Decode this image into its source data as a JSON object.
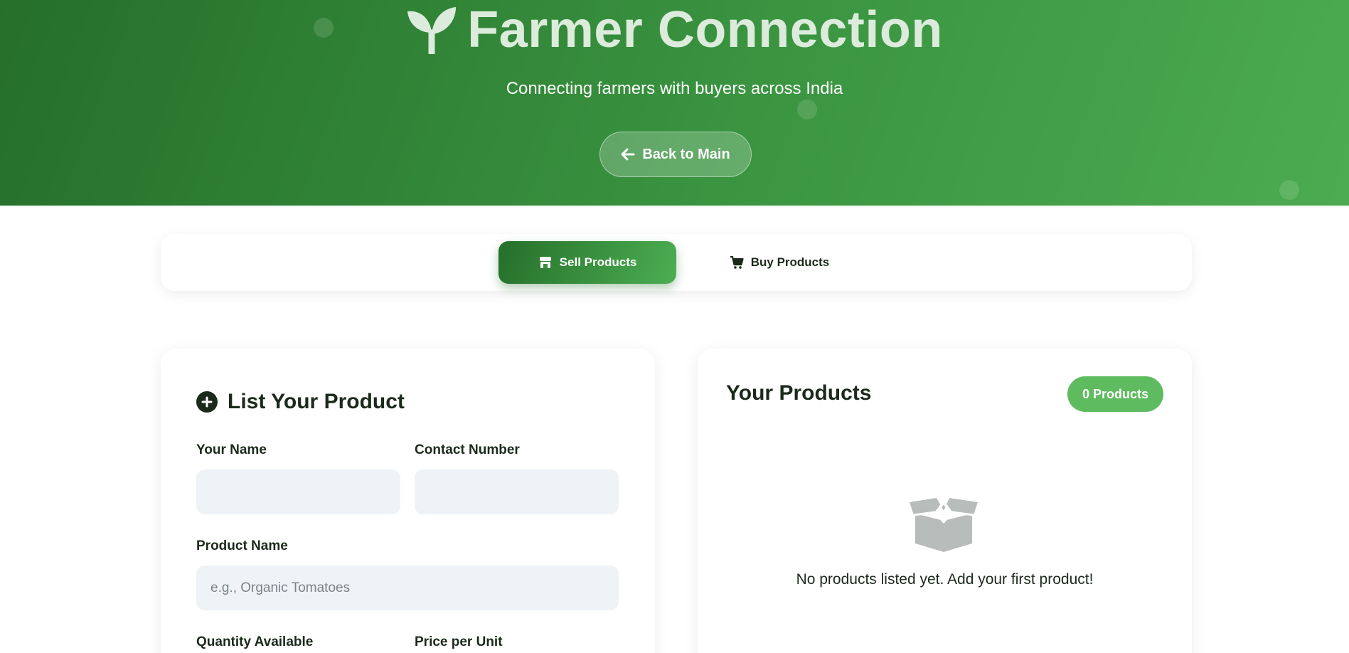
{
  "header": {
    "title": "Farmer Connection",
    "subtitle": "Connecting farmers with buyers across India",
    "back_button": "Back to Main",
    "logo_icon": "seedling-icon"
  },
  "tabs": [
    {
      "label": "Sell Products",
      "icon": "store-icon",
      "active": true
    },
    {
      "label": "Buy Products",
      "icon": "cart-icon",
      "active": false
    }
  ],
  "form": {
    "title": "List Your Product",
    "title_icon": "plus-circle-icon",
    "fields": {
      "name": {
        "label": "Your Name",
        "value": "",
        "placeholder": ""
      },
      "contact": {
        "label": "Contact Number",
        "value": "",
        "placeholder": ""
      },
      "product": {
        "label": "Product Name",
        "value": "",
        "placeholder": "e.g., Organic Tomatoes"
      },
      "quantity": {
        "label": "Quantity Available"
      },
      "price": {
        "label": "Price per Unit"
      }
    }
  },
  "products": {
    "title": "Your Products",
    "count_badge": "0 Products",
    "empty_icon": "open-box-icon",
    "empty_message": "No products listed yet. Add your first product!"
  },
  "colors": {
    "brand_dark": "#256f2a",
    "brand_light": "#4cab50",
    "badge": "#5fbb5f",
    "input_bg": "#eff3f7"
  }
}
